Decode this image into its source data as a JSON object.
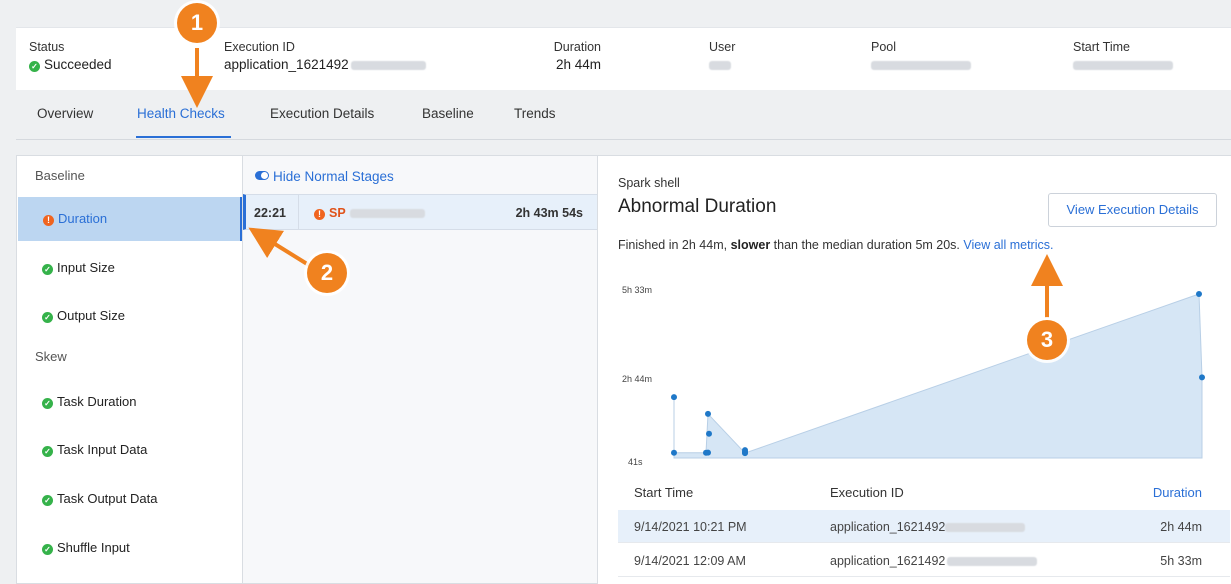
{
  "summary": {
    "status": {
      "label": "Status",
      "value": "Succeeded"
    },
    "execution_id": {
      "label": "Execution ID",
      "value": "application_1621492"
    },
    "duration": {
      "label": "Duration",
      "value": "2h 44m"
    },
    "user": {
      "label": "User"
    },
    "pool": {
      "label": "Pool"
    },
    "start_time": {
      "label": "Start Time"
    }
  },
  "tabs": [
    "Overview",
    "Health Checks",
    "Execution Details",
    "Baseline",
    "Trends"
  ],
  "active_tab": "Health Checks",
  "sidebar": {
    "baseline_title": "Baseline",
    "baseline_items": [
      "Duration",
      "Input Size",
      "Output Size"
    ],
    "skew_title": "Skew",
    "skew_items": [
      "Task Duration",
      "Task Input Data",
      "Task Output Data",
      "Shuffle Input"
    ]
  },
  "stages": {
    "toggle_label": "Hide Normal Stages",
    "row": {
      "time": "22:21",
      "name": "SP",
      "duration": "2h 43m 54s"
    }
  },
  "detail": {
    "subtitle": "Spark shell",
    "title": "Abnormal Duration",
    "button": "View Execution Details",
    "desc_prefix": "Finished in 2h 44m,",
    "desc_bold": "slower",
    "desc_mid": "than the median duration 5m 20s.",
    "desc_link": "View all metrics."
  },
  "chart_data": {
    "type": "area",
    "y_ticks": [
      "5h 33m",
      "2h 44m",
      "41s"
    ],
    "series": [
      {
        "values_seconds": [
          7440,
          680,
          670,
          700,
          5400,
          2980,
          740,
          1000,
          640,
          760,
          19980,
          9840
        ]
      }
    ]
  },
  "table": {
    "headers": [
      "Start Time",
      "Execution ID",
      "Duration"
    ],
    "rows": [
      {
        "start_time": "9/14/2021 10:21 PM",
        "execution_id": "application_1621492",
        "duration": "2h 44m"
      },
      {
        "start_time": "9/14/2021 12:09 AM",
        "execution_id": "application_1621492",
        "duration": "5h 33m"
      }
    ]
  },
  "annotations": [
    "1",
    "2",
    "3"
  ],
  "colors": {
    "accent": "#2a6fd6",
    "ok": "#35b24a",
    "warn": "#f0641f",
    "annotation": "#f0821f",
    "chart_fill": "#d6e6f5",
    "chart_point": "#1f78c8"
  }
}
